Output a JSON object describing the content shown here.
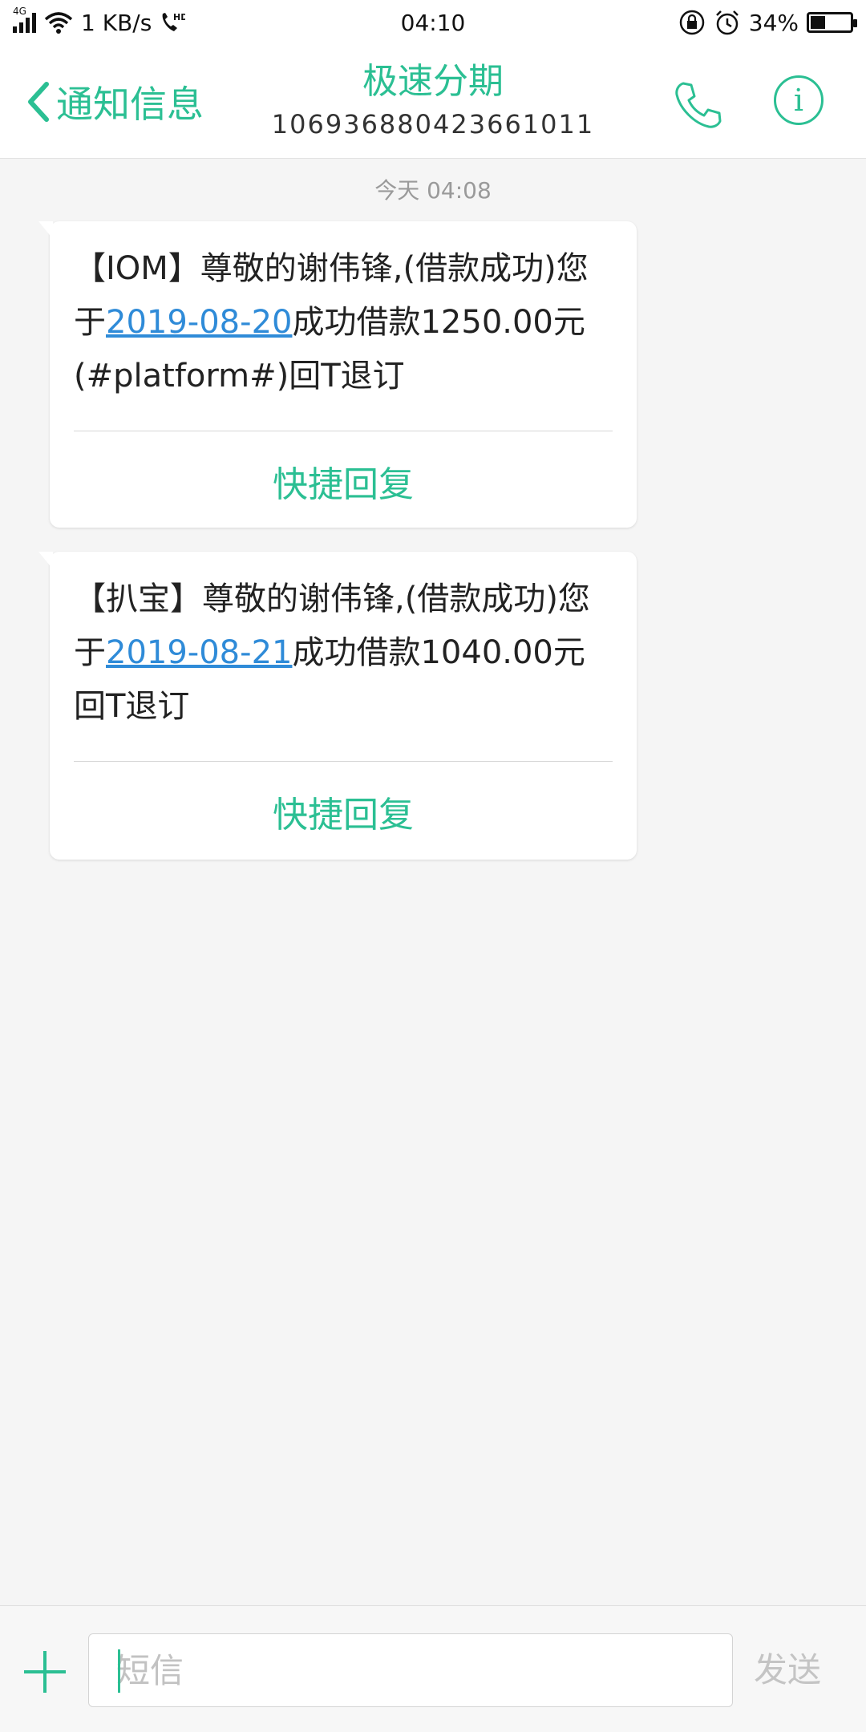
{
  "status_bar": {
    "network_type": "4G",
    "speed": "1 KB/s",
    "hd_label": "HD",
    "time": "04:10",
    "battery_percent": "34%",
    "battery_level": 0.34,
    "icons": [
      "signal-icon",
      "wifi-icon",
      "hd-call-icon",
      "rotation-lock-icon",
      "alarm-icon",
      "battery-icon"
    ]
  },
  "header": {
    "back_label": "通知信息",
    "contact_name": "极速分期",
    "contact_number": "106936880423661011",
    "accent_color": "#2bbf93"
  },
  "conversation": {
    "timestamp": "今天 04:08",
    "messages": [
      {
        "text_before": "【IOM】尊敬的谢伟锋,(借款成功)您于",
        "date": "2019-08-20",
        "text_after": "成功借款1250.00元(#platform#)回T退订",
        "quick_reply": "快捷回复"
      },
      {
        "text_before": "【扒宝】尊敬的谢伟锋,(借款成功)您于",
        "date": "2019-08-21",
        "text_after": "成功借款1040.00元回T退订",
        "quick_reply": "快捷回复"
      }
    ]
  },
  "input_bar": {
    "value": "",
    "placeholder": "短信",
    "send_label": "发送"
  }
}
